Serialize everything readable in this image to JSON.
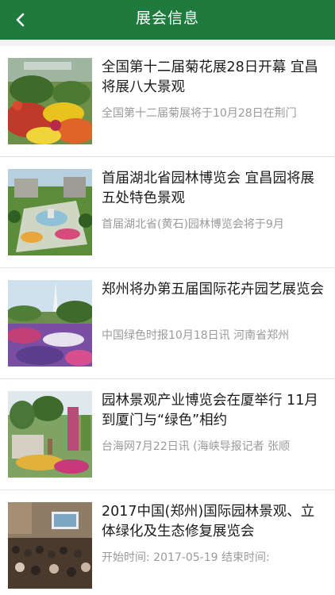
{
  "header": {
    "title": "展会信息",
    "back_icon": "chevron-left-icon"
  },
  "colors": {
    "header_bg": "#1f7a3d",
    "title_text": "#1c1c1c",
    "summary_text": "#9a9a9a",
    "divider": "#e3e3e3"
  },
  "news": [
    {
      "title": "全国第十二届菊花展28日开幕 宜昌将展八大景观",
      "summary": "全国第十二届菊展将于10月28日在荆门"
    },
    {
      "title": "首届湖北省园林博览会 宜昌园将展五处特色景观",
      "summary": "首届湖北省(黄石)园林博览会将于9月"
    },
    {
      "title": "郑州将办第五届国际花卉园艺展览会",
      "summary": "中国绿色时报10月18日讯 河南省郑州"
    },
    {
      "title": "园林景观产业博览会在厦举行 11月到厦门与“绿色”相约",
      "summary": "台海网7月22日讯 (海峡导报记者 张顺"
    },
    {
      "title": "2017中国(郑州)国际园林景观、立体绿化及生态修复展览会",
      "summary": "开始时间: 2017-05-19 结束时间:"
    }
  ]
}
